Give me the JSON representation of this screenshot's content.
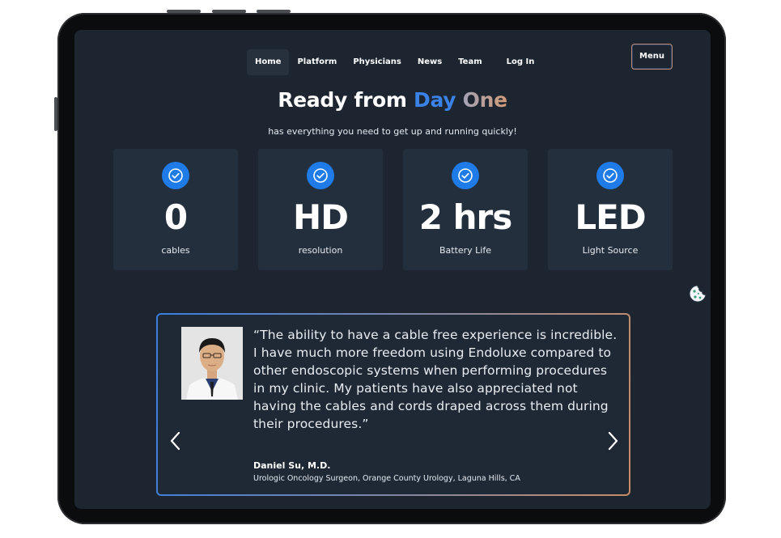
{
  "nav": {
    "items": [
      "Home",
      "Platform",
      "Physicians",
      "News",
      "Team"
    ],
    "login": "Log In",
    "menu": "Menu"
  },
  "hero": {
    "title_part1": "Ready from ",
    "title_part2": "Day",
    "title_part3": " One",
    "subtitle": "has everything you need to get up and running quickly!"
  },
  "stats": [
    {
      "value": "0",
      "label": "cables"
    },
    {
      "value": "HD",
      "label": "resolution"
    },
    {
      "value": "2 hrs",
      "label": "Battery Life"
    },
    {
      "value": "LED",
      "label": "Light Source"
    }
  ],
  "testimonial": {
    "quote": "“The ability to have a cable free experience is incredible. I have much more freedom using Endoluxe compared to other endoscopic systems when performing procedures in my clinic. My patients have also appreciated not having the cables and cords draped across them during their procedures.”",
    "author": "Daniel Su, M.D.",
    "role": "Urologic Oncology Surgeon, Orange County Urology, Laguna Hills, CA"
  },
  "icons": {
    "stat_icon": "check-circle-icon",
    "prev": "chevron-left-icon",
    "next": "chevron-right-icon",
    "cookie": "cookie-icon"
  },
  "colors": {
    "background": "#1c2530",
    "card": "#232f3c",
    "accent_blue": "#1f7be8",
    "accent_peach": "#d49c78"
  }
}
